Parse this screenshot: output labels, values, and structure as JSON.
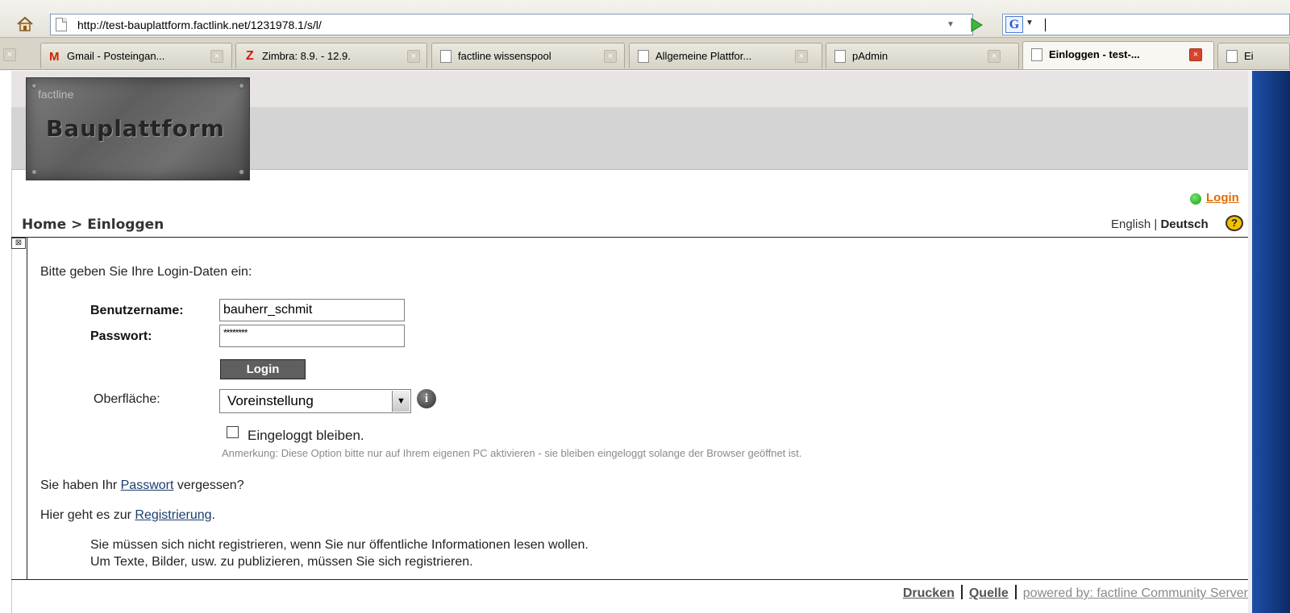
{
  "browser": {
    "url": "http://test-bauplattform.factlink.net/1231978.1/s/l/",
    "search_engine_letter": "G",
    "tabs": [
      {
        "label": "Gmail - Posteingan...",
        "icon": "gmail-icon"
      },
      {
        "label": "Zimbra: 8.9. - 12.9.",
        "icon": "zimbra-icon",
        "icon_text": "Z"
      },
      {
        "label": "factline wissenspool",
        "icon": "page-icon"
      },
      {
        "label": "Allgemeine Plattfor...",
        "icon": "page-icon"
      },
      {
        "label": "pAdmin",
        "icon": "page-icon"
      },
      {
        "label": "Einloggen - test-...",
        "icon": "page-icon",
        "active": true
      },
      {
        "label": "Ei",
        "icon": "page-icon"
      }
    ]
  },
  "site": {
    "logo_small": "factline",
    "logo_big": "Bauplattform",
    "login_link": "Login",
    "breadcrumb": "Home > Einloggen",
    "lang_english": "English",
    "lang_sep": " | ",
    "lang_deutsch": "Deutsch",
    "help_symbol": "?"
  },
  "form": {
    "intro": "Bitte geben Sie Ihre Login-Daten ein:",
    "username_label": "Benutzername:",
    "username_value": "bauherr_schmit",
    "password_label": "Passwort:",
    "password_value": "********",
    "login_button": "Login",
    "surface_label": "Oberfläche:",
    "surface_value": "Voreinstellung",
    "info_symbol": "i",
    "remember_label": "Eingeloggt bleiben.",
    "remember_checked": false,
    "remember_note": "Anmerkung: Diese Option bitte nur auf Ihrem eigenen PC aktivieren - sie bleiben eingeloggt solange der Browser geöffnet ist."
  },
  "links": {
    "forgot_prefix": "Sie haben Ihr ",
    "forgot_link": "Passwort",
    "forgot_suffix": " vergessen?",
    "register_prefix": "Hier geht es zur ",
    "register_link": "Registrierung",
    "register_suffix": ".",
    "info_line1": "Sie müssen sich nicht registrieren, wenn Sie nur öffentliche Informationen lesen wollen.",
    "info_line2": "Um Texte, Bilder, usw. zu publizieren, müssen Sie sich registrieren."
  },
  "footer": {
    "print": "Drucken",
    "source": "Quelle",
    "powered": "powered by: factline Community Server"
  },
  "colors": {
    "login_link": "#e36a00",
    "link": "#1a3d6e",
    "active_tab_close": "#d9442c",
    "login_button_bg": "#5f5f5f"
  }
}
